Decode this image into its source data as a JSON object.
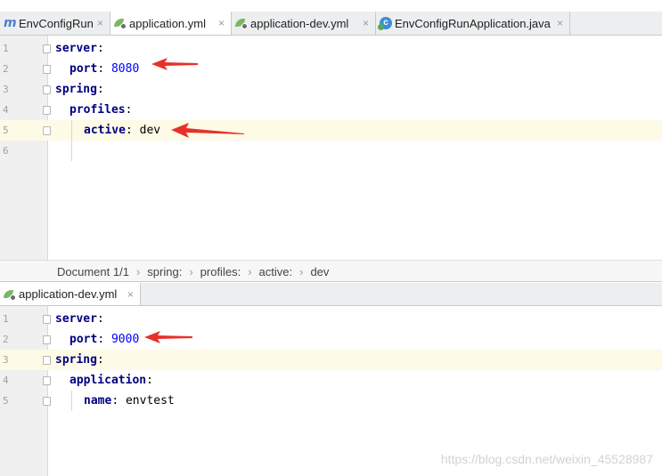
{
  "tabs_top": [
    {
      "label": "EnvConfigRun",
      "icon": "maven-m-icon",
      "active": false
    },
    {
      "label": "application.yml",
      "icon": "spring-yml-icon",
      "active": true
    },
    {
      "label": "application-dev.yml",
      "icon": "spring-yml-icon",
      "active": false
    },
    {
      "label": "EnvConfigRunApplication.java",
      "icon": "java-class-icon",
      "active": false
    }
  ],
  "close_glyph": "×",
  "editor_top": {
    "lines": [
      {
        "num": "1",
        "key": "server",
        "sep": ":",
        "value": ""
      },
      {
        "num": "2",
        "key": "port",
        "sep": ": ",
        "value": "8080"
      },
      {
        "num": "3",
        "key": "spring",
        "sep": ":",
        "value": ""
      },
      {
        "num": "4",
        "key": "profiles",
        "sep": ":",
        "value": ""
      },
      {
        "num": "5",
        "key": "active",
        "sep": ": ",
        "value": "dev"
      },
      {
        "num": "6",
        "key": "",
        "sep": "",
        "value": ""
      }
    ]
  },
  "breadcrumb": {
    "items": [
      "Document 1/1",
      "spring:",
      "profiles:",
      "active:",
      "dev"
    ],
    "separator": "›"
  },
  "tab_bottom": {
    "label": "application-dev.yml",
    "icon": "spring-yml-icon"
  },
  "editor_bottom": {
    "lines": [
      {
        "num": "1",
        "key": "server",
        "sep": ":",
        "value": ""
      },
      {
        "num": "2",
        "key": "port",
        "sep": ": ",
        "value": "9000"
      },
      {
        "num": "3",
        "key": "spring",
        "sep": ":",
        "value": ""
      },
      {
        "num": "4",
        "key": "application",
        "sep": ":",
        "value": ""
      },
      {
        "num": "5",
        "key": "name",
        "sep": ": ",
        "value": "envtest"
      }
    ]
  },
  "watermark": "https://blog.csdn.net/weixin_45528987",
  "colors": {
    "key": "#000080",
    "number": "#0000ff",
    "arrow": "#e8302a",
    "current_line": "#fdfae6"
  }
}
